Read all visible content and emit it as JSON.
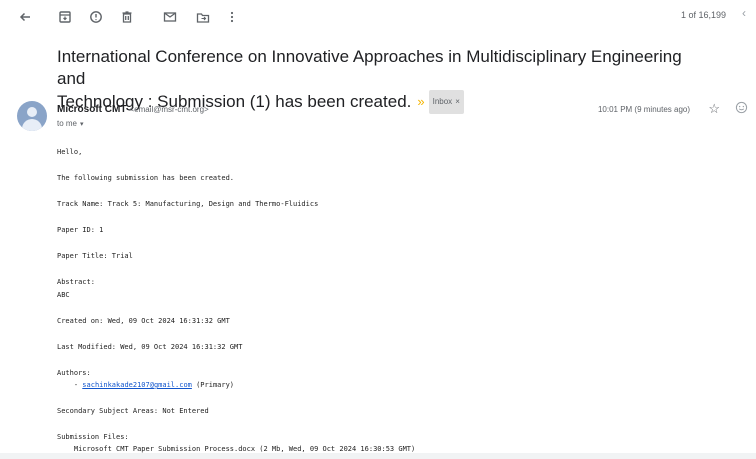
{
  "toolbar": {
    "back_icon": "arrow-left-icon",
    "archive_icon": "archive-icon",
    "report_icon": "report-spam-icon",
    "delete_icon": "trash-icon",
    "unread_icon": "mark-unread-icon",
    "move_icon": "move-to-icon",
    "more_icon": "more-vert-icon",
    "pager": "1 of 16,199",
    "prev_icon": "chevron-left-icon"
  },
  "email": {
    "subject_line1": "International Conference on Innovative Approaches in Multidisciplinary Engineering and",
    "subject_line2": "Technology : Submission (1) has been created.",
    "label": "Inbox",
    "label_close": "×",
    "importance_marker": "»",
    "sender_name": "Microsoft CMT",
    "sender_email": "<email@msr-cmt.org>",
    "to": "to me",
    "timestamp": "10:01 PM (9 minutes ago)",
    "star_icon": "star-outline-icon",
    "emoji_icon": "add-reaction-icon"
  },
  "body": {
    "greeting": "Hello,",
    "intro": "The following submission has been created.",
    "track": "Track Name: Track 5: Manufacturing, Design and Thermo-Fluidics",
    "paper_id": "Paper ID: 1",
    "paper_title": "Paper Title: Trial",
    "abstract_label": "Abstract:",
    "abstract_value": "ABC",
    "created": "Created on: Wed, 09 Oct 2024 16:31:32 GMT",
    "modified": "Last Modified: Wed, 09 Oct 2024 16:31:32 GMT",
    "authors_label": "Authors:",
    "author_prefix": "    - ",
    "author_email": "sachinkakade2107@gmail.com",
    "author_role": " (Primary)",
    "secondary_subjects": "Secondary Subject Areas: Not Entered",
    "files_label": "Submission Files:",
    "file_entry": "    Microsoft CMT Paper Submission Process.docx (2 Mb, Wed, 09 Oct 2024 16:30:53 GMT)"
  }
}
